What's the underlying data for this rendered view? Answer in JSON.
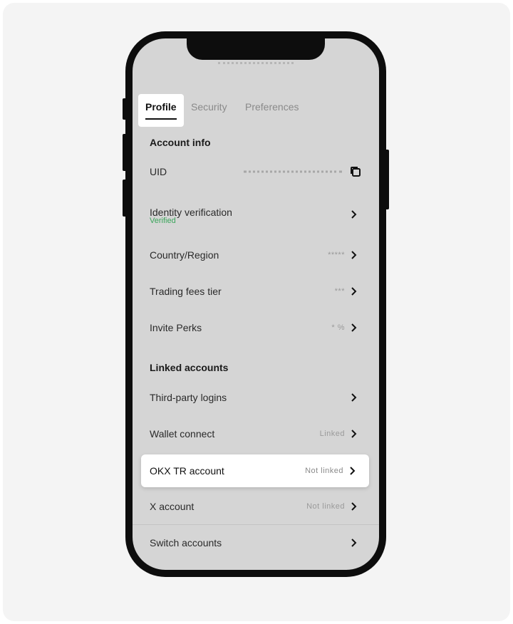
{
  "tabs": [
    {
      "label": "Profile",
      "active": true
    },
    {
      "label": "Security",
      "active": false
    },
    {
      "label": "Preferences",
      "active": false
    }
  ],
  "account_info": {
    "title": "Account info",
    "uid_label": "UID",
    "identity_label": "Identity verification",
    "identity_status": "Verified",
    "country_label": "Country/Region",
    "country_value": "*****",
    "fees_label": "Trading fees tier",
    "fees_value": "***",
    "invite_label": "Invite Perks",
    "invite_value": "* %"
  },
  "linked_accounts": {
    "title": "Linked accounts",
    "third_party_label": "Third-party logins",
    "wallet_label": "Wallet connect",
    "wallet_value": "Linked",
    "okx_tr_label": "OKX TR account",
    "okx_tr_value": "Not linked",
    "x_label": "X account",
    "x_value": "Not linked",
    "switch_label": "Switch accounts"
  },
  "colors": {
    "screen_bg": "#d5d5d5",
    "verified_green": "#3aa55a",
    "phone_frame": "#0d0d0d"
  }
}
